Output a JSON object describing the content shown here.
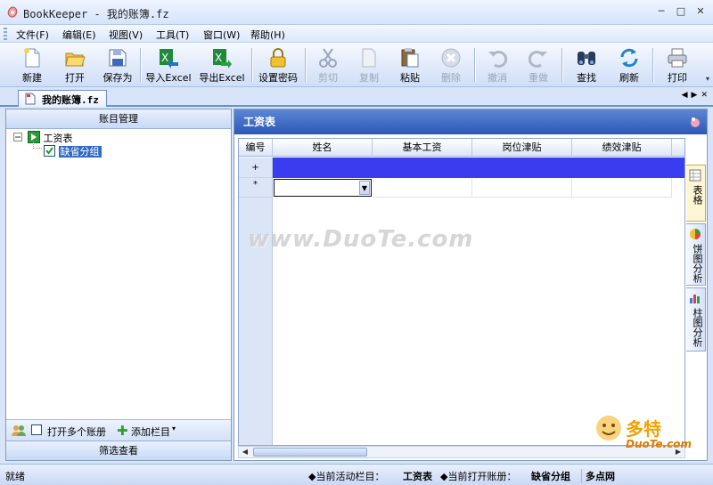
{
  "window": {
    "title": "BookKeeper - 我的账簿.fz"
  },
  "menu": [
    "文件(F)",
    "编辑(E)",
    "视图(V)",
    "工具(T)",
    "窗口(W)",
    "帮助(H)"
  ],
  "toolbar": {
    "new": "新建",
    "open": "打开",
    "save_as": "保存为",
    "import_excel": "导入Excel",
    "export_excel": "导出Excel",
    "set_password": "设置密码",
    "cut": "剪切",
    "copy": "复制",
    "paste": "粘贴",
    "delete": "删除",
    "undo": "撤消",
    "redo": "重做",
    "find": "查找",
    "refresh": "刷新",
    "print": "打印"
  },
  "doc_tab": {
    "label": "我的账簿.fz"
  },
  "left_panel": {
    "title": "账目管理",
    "tree": {
      "root": "工资表",
      "child": "缺省分组"
    },
    "footer": {
      "open_multiple": "打开多个账册",
      "add_column": "添加栏目"
    },
    "filter_button": "筛选查看"
  },
  "right_panel": {
    "title": "工资表",
    "columns": [
      "编号",
      "姓名",
      "基本工资",
      "岗位津贴",
      "绩效津贴"
    ],
    "row_markers": {
      "new_row": "+",
      "edit_row": "*"
    },
    "side_tabs": [
      "表格",
      "饼图分析",
      "柱图分析"
    ]
  },
  "status": {
    "ready": "就绪",
    "active_column_label": "◆当前活动栏目：",
    "active_column_value": "工资表",
    "open_book_label": "◆当前打开账册：",
    "open_book_value": "缺省分组",
    "brand": "多点网"
  },
  "watermark": {
    "center": "www.DuoTe.com",
    "corner_big": "多特",
    "corner_small": "DuoTe.com"
  }
}
